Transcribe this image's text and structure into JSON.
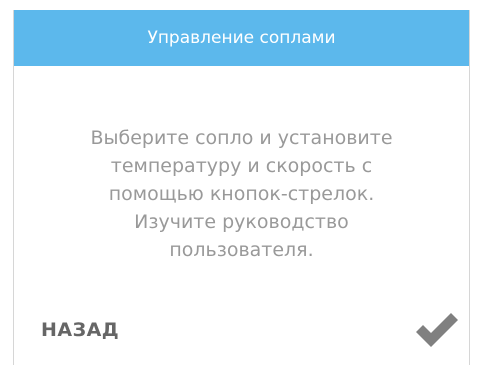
{
  "header": {
    "title": "Управление соплами"
  },
  "body": {
    "message": "Выберите сопло и установите\nтемпературу и скорость с\nпомощью кнопок-стрелок.\nИзучите руководство\nпользователя."
  },
  "footer": {
    "back_label": "НАЗАД",
    "confirm_icon": "checkmark-icon"
  },
  "colors": {
    "header_bg": "#5cb8ec",
    "header_text": "#ffffff",
    "message_text": "#999999",
    "back_text": "#666666",
    "check_icon": "#808080"
  }
}
